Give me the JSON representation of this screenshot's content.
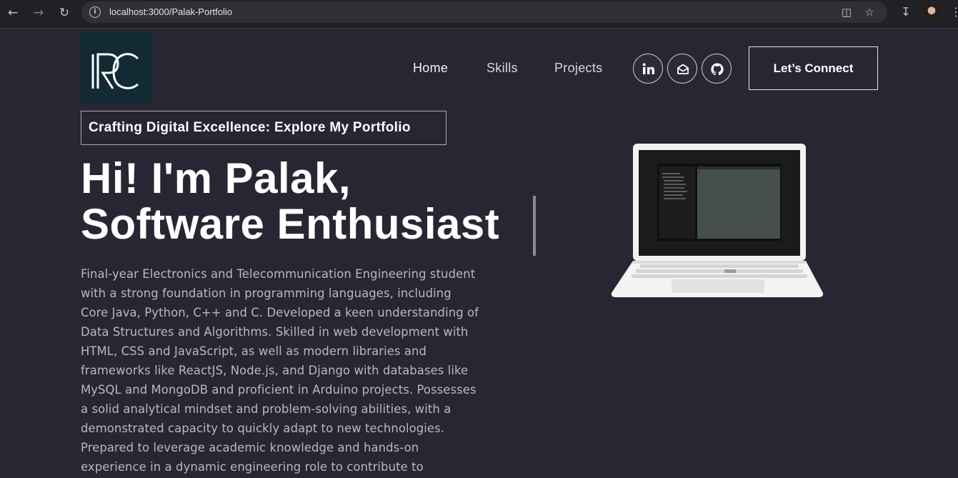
{
  "browser": {
    "url": "localhost:3000/Palak-Portfolio"
  },
  "logo": {
    "text": "RC"
  },
  "nav": {
    "links": [
      "Home",
      "Skills",
      "Projects"
    ],
    "connect_label": "Let’s Connect",
    "social": [
      "linkedin-icon",
      "mail-icon",
      "github-icon"
    ]
  },
  "hero": {
    "tagline": "Crafting Digital Excellence: Explore My Portfolio",
    "title_line1": "Hi! I'm Palak,",
    "title_line2": "Software Enthusiast",
    "bio_lines": [
      "Final-year Electronics and Telecommunication Engineering student",
      "with a strong foundation in programming languages, including",
      "Core Java, Python, C++ and C. Developed a keen understanding of",
      "Data Structures and Algorithms. Skilled in web development with",
      "HTML, CSS and JavaScript, as well as modern libraries and",
      "frameworks like ReactJS, Node.js, and Django with databases like",
      "MySQL and MongoDB and proficient in Arduino projects. Possesses",
      "a solid analytical mindset and problem-solving abilities, with a",
      "demonstrated capacity to quickly adapt to new technologies.",
      "Prepared to leverage academic knowledge and hands-on",
      "experience in a dynamic engineering role to contribute to"
    ]
  },
  "colors": {
    "page_bg": "#272733",
    "logo_bg": "#122a33",
    "chrome_bg": "#202124"
  }
}
